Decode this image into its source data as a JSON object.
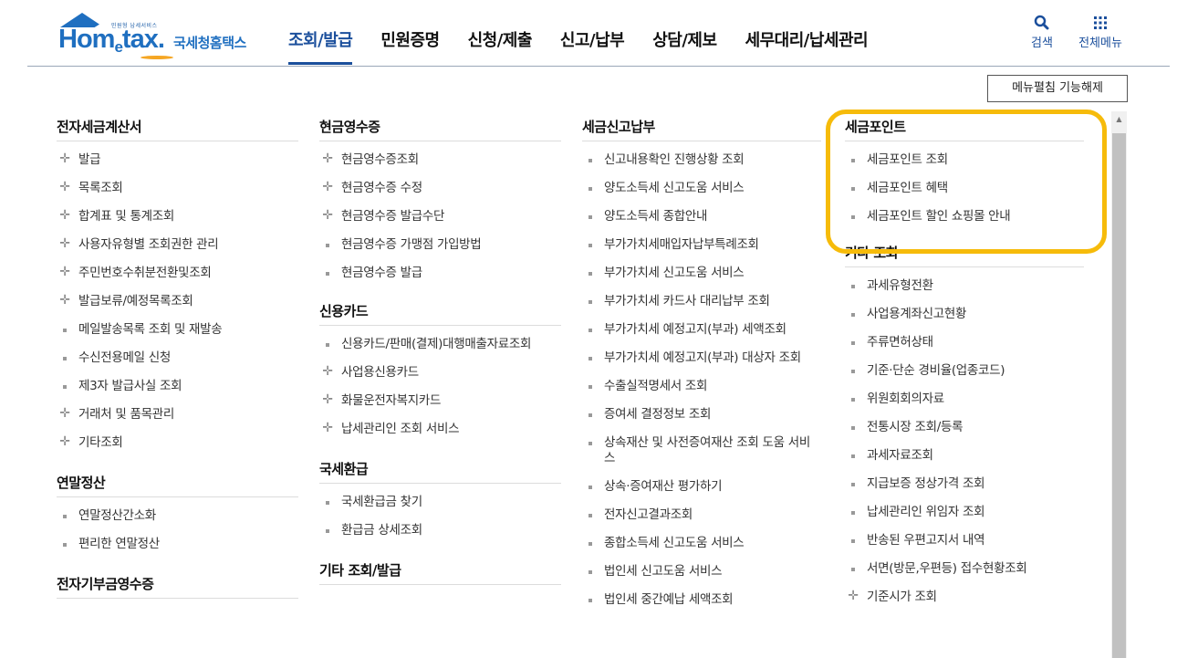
{
  "header": {
    "logo_small": "민원형 납세서비스",
    "logo_main": "Hom",
    "logo_e": "e",
    "logo_tail": "tax.",
    "logo_kr": "국세청홈택스",
    "nav": [
      "조회/발급",
      "민원증명",
      "신청/제출",
      "신고/납부",
      "상담/제보",
      "세무대리/납세관리"
    ],
    "active_nav": "조회/발급",
    "search_label": "검색",
    "all_menu_label": "전체메뉴"
  },
  "menu_toggle_label": "메뉴펼침 기능해제",
  "columns": {
    "col1": [
      {
        "title": "전자세금계산서",
        "items": [
          {
            "b": "plus",
            "t": "발급"
          },
          {
            "b": "plus",
            "t": "목록조회"
          },
          {
            "b": "plus",
            "t": "합계표 및 통계조회"
          },
          {
            "b": "plus",
            "t": "사용자유형별 조회권한 관리"
          },
          {
            "b": "plus",
            "t": "주민번호수취분전환및조회"
          },
          {
            "b": "plus",
            "t": "발급보류/예정목록조회"
          },
          {
            "b": "sq",
            "t": "메일발송목록 조회 및 재발송"
          },
          {
            "b": "sq",
            "t": "수신전용메일 신청"
          },
          {
            "b": "sq",
            "t": "제3자 발급사실 조회"
          },
          {
            "b": "plus",
            "t": "거래처 및 품목관리"
          },
          {
            "b": "plus",
            "t": "기타조회"
          }
        ]
      },
      {
        "title": "연말정산",
        "items": [
          {
            "b": "sq",
            "t": "연말정산간소화"
          },
          {
            "b": "sq",
            "t": "편리한 연말정산"
          }
        ]
      },
      {
        "title": "전자기부금영수증",
        "items": []
      }
    ],
    "col2": [
      {
        "title": "현금영수증",
        "items": [
          {
            "b": "plus",
            "t": "현금영수증조회"
          },
          {
            "b": "plus",
            "t": "현금영수증 수정"
          },
          {
            "b": "plus",
            "t": "현금영수증 발급수단"
          },
          {
            "b": "sq",
            "t": "현금영수증 가맹점 가입방법"
          },
          {
            "b": "sq",
            "t": "현금영수증 발급"
          }
        ]
      },
      {
        "title": "신용카드",
        "items": [
          {
            "b": "sq",
            "t": "신용카드/판매(결제)대행매출자료조회"
          },
          {
            "b": "plus",
            "t": "사업용신용카드"
          },
          {
            "b": "plus",
            "t": "화물운전자복지카드"
          },
          {
            "b": "plus",
            "t": "납세관리인 조회 서비스"
          }
        ]
      },
      {
        "title": "국세환급",
        "items": [
          {
            "b": "sq",
            "t": "국세환급금 찾기"
          },
          {
            "b": "sq",
            "t": "환급금 상세조회"
          }
        ]
      },
      {
        "title": "기타 조회/발급",
        "items": []
      }
    ],
    "col3": [
      {
        "title": "세금신고납부",
        "items": [
          {
            "b": "sq",
            "t": "신고내용확인 진행상황 조회"
          },
          {
            "b": "sq",
            "t": "양도소득세 신고도움 서비스"
          },
          {
            "b": "sq",
            "t": "양도소득세 종합안내"
          },
          {
            "b": "sq",
            "t": "부가가치세매입자납부특례조회"
          },
          {
            "b": "sq",
            "t": "부가가치세 신고도움 서비스"
          },
          {
            "b": "sq",
            "t": "부가가치세 카드사 대리납부 조회"
          },
          {
            "b": "sq",
            "t": "부가가치세 예정고지(부과) 세액조회"
          },
          {
            "b": "sq",
            "t": "부가가치세 예정고지(부과) 대상자 조회"
          },
          {
            "b": "sq",
            "t": "수출실적명세서 조회"
          },
          {
            "b": "sq",
            "t": "증여세 결정정보 조회"
          },
          {
            "b": "sq",
            "t": "상속재산 및 사전증여재산 조회 도움 서비스"
          },
          {
            "b": "sq",
            "t": "상속·증여재산 평가하기"
          },
          {
            "b": "sq",
            "t": "전자신고결과조회"
          },
          {
            "b": "sq",
            "t": "종합소득세 신고도움 서비스"
          },
          {
            "b": "sq",
            "t": "법인세 신고도움 서비스"
          },
          {
            "b": "sq",
            "t": "법인세 중간예납 세액조회"
          }
        ]
      }
    ],
    "col4": [
      {
        "title": "세금포인트",
        "items": [
          {
            "b": "sq",
            "t": "세금포인트 조회"
          },
          {
            "b": "sq",
            "t": "세금포인트 혜택"
          },
          {
            "b": "sq",
            "t": "세금포인트 할인 쇼핑몰 안내"
          }
        ]
      },
      {
        "title": "기타 조회",
        "items": [
          {
            "b": "sq",
            "t": "과세유형전환"
          },
          {
            "b": "sq",
            "t": "사업용계좌신고현황"
          },
          {
            "b": "sq",
            "t": "주류면허상태"
          },
          {
            "b": "sq",
            "t": "기준·단순 경비율(업종코드)"
          },
          {
            "b": "sq",
            "t": "위원회회의자료"
          },
          {
            "b": "sq",
            "t": "전통시장 조회/등록"
          },
          {
            "b": "sq",
            "t": "과세자료조회"
          },
          {
            "b": "sq",
            "t": "지급보증 정상가격 조회"
          },
          {
            "b": "sq",
            "t": "납세관리인 위임자 조회"
          },
          {
            "b": "sq",
            "t": "반송된 우편고지서 내역"
          },
          {
            "b": "sq",
            "t": "서면(방문,우편등) 접수현황조회"
          },
          {
            "b": "plus",
            "t": "기준시가 조회"
          }
        ]
      }
    ]
  },
  "colors": {
    "accent": "#1b4f9c",
    "highlight": "#f6bb0a"
  }
}
